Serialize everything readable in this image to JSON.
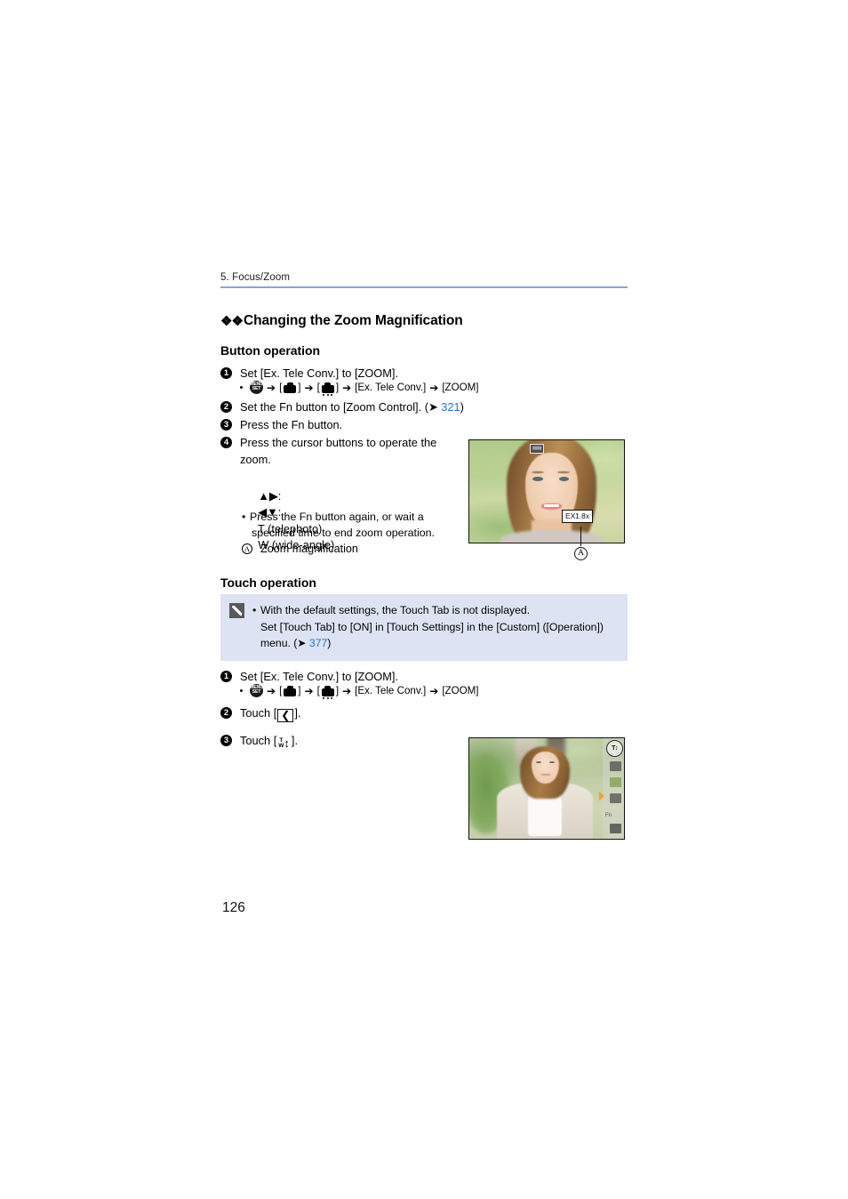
{
  "header": {
    "running_head": "5. Focus/Zoom"
  },
  "page_number": "126",
  "section": {
    "title": "Changing the Zoom Magnification",
    "bullet_icon": "double-diamond-icon"
  },
  "button_operation": {
    "heading": "Button operation",
    "steps": [
      {
        "num": "1",
        "text": "Set [Ex. Tele Conv.] to [ZOOM]."
      },
      {
        "num": "2",
        "text": "Set the Fn button to [Zoom Control]. (➔ 321)"
      },
      {
        "num": "3",
        "text": "Press the Fn button."
      },
      {
        "num": "4",
        "text": "Press the cursor buttons to operate the zoom."
      }
    ],
    "step2_link": "321",
    "menu_path": {
      "icon_menuset": "menu-set-icon",
      "icon_rec": "rec-camera-icon",
      "icon_rec_dots": "rec-camera-others-icon",
      "item1": "[Ex. Tele Conv.]",
      "item2": "[ZOOM]",
      "arrow": "➔",
      "bracket_open": "[",
      "bracket_close": "]"
    },
    "cursor_lines": [
      {
        "keys": "▲▶:",
        "desc": "T (telephoto)"
      },
      {
        "keys": "◀▼:",
        "desc": "W (wide-angle)"
      }
    ],
    "note_lines": [
      "Press the Fn button again, or wait a",
      "specified time to end zoom operation."
    ],
    "callout": {
      "marker": "A",
      "label": "Zoom magnification"
    }
  },
  "touch_operation": {
    "heading": "Touch operation",
    "note_box": {
      "icon": "note-pencil-icon",
      "lines": [
        "With the default settings, the Touch Tab is not displayed.",
        "Set [Touch Tab] to [ON] in [Touch Settings] in the [Custom] ([Operation])",
        "menu. (➔ 377)"
      ],
      "link": "377",
      "background_color": "#dde3f3"
    },
    "steps": [
      {
        "num": "1",
        "text": "Set [Ex. Tele Conv.] to [ZOOM]."
      },
      {
        "num": "2",
        "text_prefix": "Touch [",
        "icon": "touch-tab-left-chevron-icon",
        "icon_glyph": "❮",
        "text_suffix": "]."
      },
      {
        "num": "3",
        "text_prefix": "Touch [",
        "icon": "zoom-tw-icon",
        "icon_glyph": "↕",
        "text_suffix": "]."
      }
    ],
    "menu_path": {
      "item1": "[Ex. Tele Conv.]",
      "item2": "[ZOOM]"
    }
  },
  "screenshots": {
    "photo1": {
      "name": "camera-lcd-zoom-magnification",
      "ex_badge": "EX1.8x",
      "top_chip": "zoom-icon",
      "callout_marker": "A"
    },
    "photo2": {
      "name": "camera-lcd-touch-tab-zoom",
      "touch_tab_items": [
        "zoom-tw-icon",
        "touch-ae-icon",
        "touch-shutter-icon",
        "touch-af-icon",
        "fn-label",
        "touch-settings-icon"
      ],
      "fn_label": "Fn"
    }
  },
  "colors": {
    "rule": "#8ba4d4",
    "link": "#2b6fd4",
    "note_bg": "#dde3f3"
  }
}
